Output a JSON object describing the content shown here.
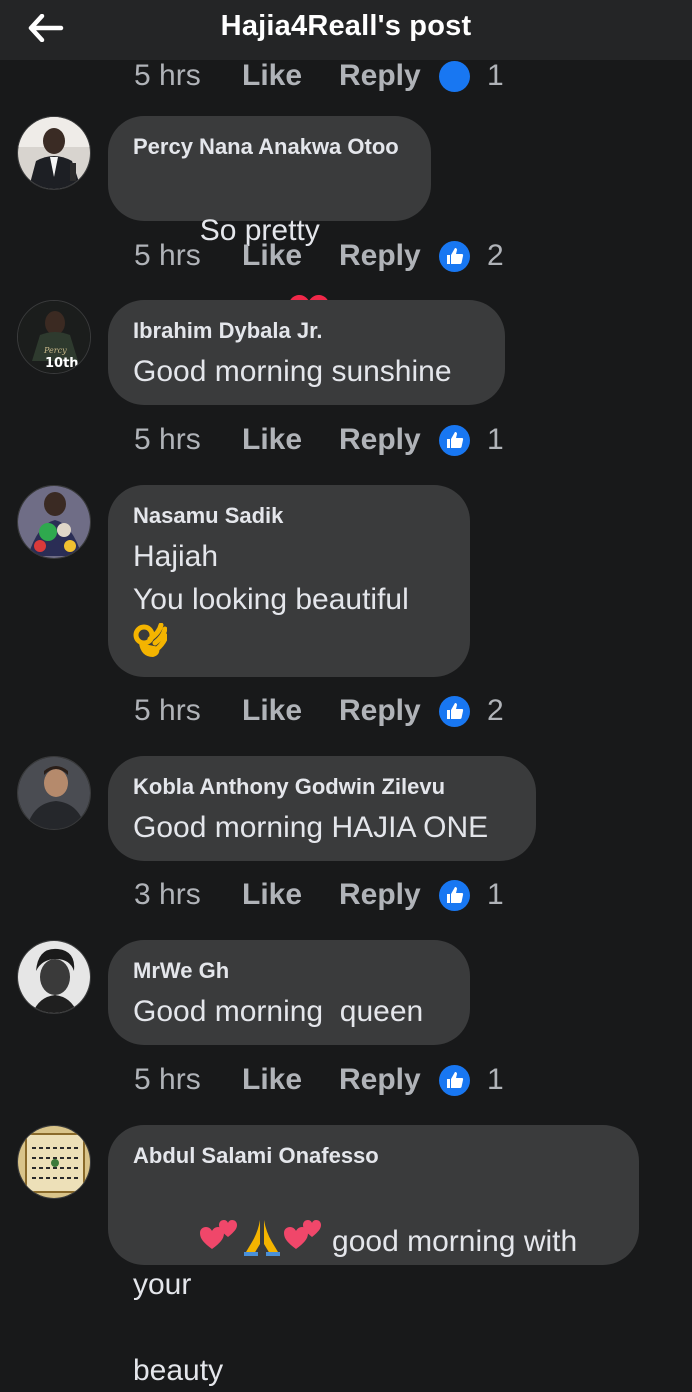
{
  "header": {
    "title": "Hajia4Reall's post",
    "back_icon": "arrow-left-icon"
  },
  "colors": {
    "background": "#18191a",
    "header_bg": "#242526",
    "bubble_bg": "#3a3b3c",
    "text_primary": "#e4e6eb",
    "text_secondary": "#b0b3b8",
    "like_blue": "#1877f2",
    "heart_red": "#f02849"
  },
  "partial_row": {
    "time": "5 hrs",
    "like_label": "Like",
    "reply_label": "Reply",
    "like_count": "1"
  },
  "comments": [
    {
      "author": "Percy Nana Anakwa Otoo",
      "text": "So pretty",
      "emoji": "❤️",
      "time": "5 hrs",
      "like_label": "Like",
      "reply_label": "Reply",
      "like_count": "2",
      "avatar": "avatar-man-suit"
    },
    {
      "author": "Ibrahim Dybala Jr.",
      "text": "Good morning sunshine",
      "time": "5 hrs",
      "like_label": "Like",
      "reply_label": "Reply",
      "like_count": "1",
      "avatar": "avatar-jersey-10th",
      "avatar_caption": "10th"
    },
    {
      "author": "Nasamu Sadik",
      "text": "Hajiah\nYou looking beautiful",
      "emoji": "👌",
      "time": "5 hrs",
      "like_label": "Like",
      "reply_label": "Reply",
      "like_count": "2",
      "avatar": "avatar-colorful-figure"
    },
    {
      "author": "Kobla Anthony Godwin Zilevu",
      "text": "Good morning HAJIA ONE",
      "time": "3 hrs",
      "like_label": "Like",
      "reply_label": "Reply",
      "like_count": "1",
      "avatar": "avatar-man-portrait"
    },
    {
      "author": "MrWe Gh",
      "text": "Good morning  queen",
      "time": "5 hrs",
      "like_label": "Like",
      "reply_label": "Reply",
      "like_count": "1",
      "avatar": "avatar-man-bw"
    },
    {
      "author": "Abdul Salami Onafesso",
      "emoji_prefix": "💕🙏💕",
      "text": " good morning with your",
      "text_cont": "beauty",
      "avatar": "avatar-calligraphy"
    }
  ]
}
